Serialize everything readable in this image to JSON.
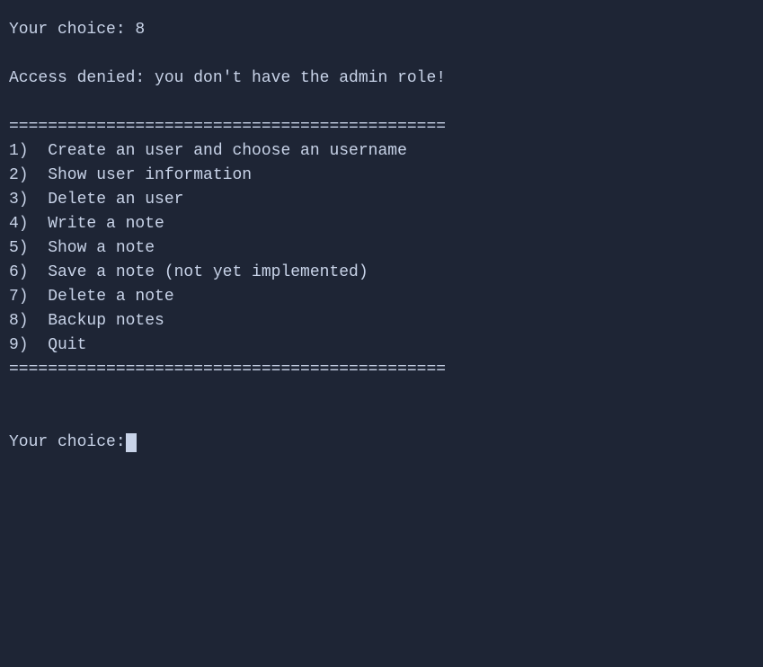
{
  "terminal": {
    "lines": [
      {
        "id": "choice-echo",
        "text": "Your choice: 8"
      },
      {
        "id": "empty1",
        "text": ""
      },
      {
        "id": "access-denied",
        "text": "Access denied: you don't have the admin role!"
      },
      {
        "id": "empty2",
        "text": ""
      },
      {
        "id": "separator1",
        "text": "============================================="
      },
      {
        "id": "menu1",
        "text": "1)  Create an user and choose an username"
      },
      {
        "id": "menu2",
        "text": "2)  Show user information"
      },
      {
        "id": "menu3",
        "text": "3)  Delete an user"
      },
      {
        "id": "menu4",
        "text": "4)  Write a note"
      },
      {
        "id": "menu5",
        "text": "5)  Show a note"
      },
      {
        "id": "menu6",
        "text": "6)  Save a note (not yet implemented)"
      },
      {
        "id": "menu7",
        "text": "7)  Delete a note"
      },
      {
        "id": "menu8",
        "text": "8)  Backup notes"
      },
      {
        "id": "menu9",
        "text": "9)  Quit"
      },
      {
        "id": "separator2",
        "text": "============================================="
      },
      {
        "id": "empty3",
        "text": ""
      },
      {
        "id": "empty4",
        "text": ""
      }
    ],
    "prompt_label": "Your choice: "
  }
}
